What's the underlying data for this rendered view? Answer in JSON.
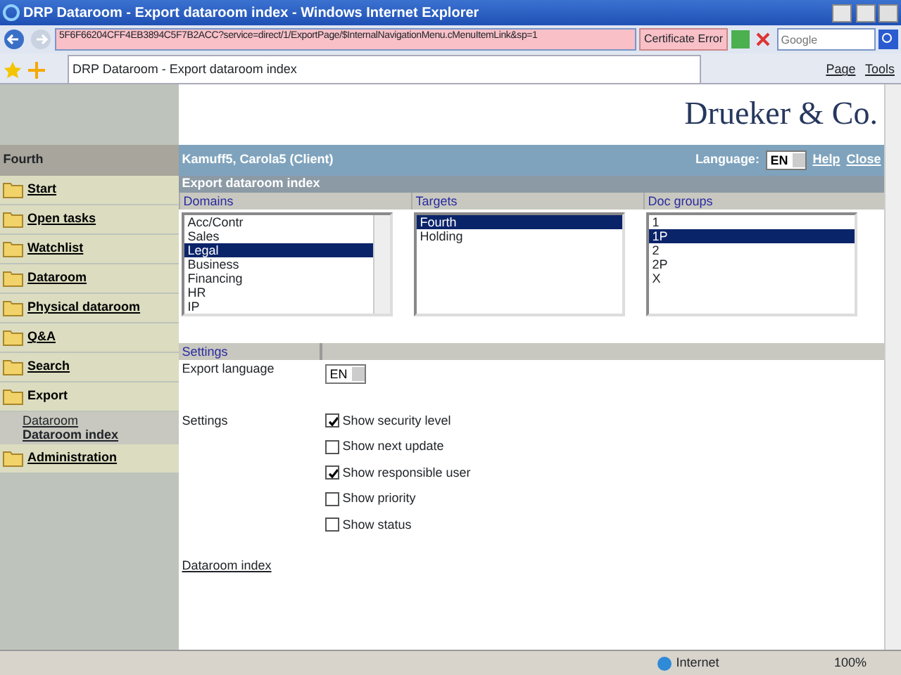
{
  "window": {
    "title": "DRP Dataroom - Export dataroom index - Windows Internet Explorer"
  },
  "address_bar": {
    "url": "5F6F66204CFF4EB3894C5F7B2ACC?service=direct/1/ExportPage/$InternalNavigationMenu.cMenuItemLink&sp=1",
    "certificate_error": "Certificate Error",
    "search": {
      "placeholder": "Google"
    }
  },
  "tabs": [
    {
      "label": "DRP Dataroom - Export dataroom index",
      "selected": true
    }
  ],
  "toolbar": {
    "items": [
      "Page",
      "Tools"
    ]
  },
  "sidebar": {
    "context": "Fourth",
    "items": [
      {
        "label": "Start",
        "selected": false
      },
      {
        "label": "Open tasks",
        "selected": false
      },
      {
        "label": "Watchlist",
        "selected": false
      },
      {
        "label": "Dataroom",
        "selected": false
      },
      {
        "label": "Physical dataroom",
        "selected": false
      },
      {
        "label": "Q&A",
        "selected": false
      },
      {
        "label": "Search",
        "selected": false
      },
      {
        "label": "Export",
        "selected": true,
        "children": [
          {
            "label": "Dataroom",
            "selected": false
          },
          {
            "label": "Dataroom index",
            "selected": true
          }
        ]
      },
      {
        "label": "Administration",
        "selected": false
      }
    ]
  },
  "header": {
    "logo": "Drueker & Co.",
    "user": "Kamuff5, Carola5 (Client)",
    "language_label": "Language:",
    "language": "EN",
    "links": [
      "Help",
      "Close"
    ]
  },
  "page_title": "Export dataroom index",
  "lists": [
    {
      "heading": "Domains",
      "items": [
        {
          "label": "Acc/Contr",
          "selected": false
        },
        {
          "label": "Sales",
          "selected": false
        },
        {
          "label": "Legal",
          "selected": true
        },
        {
          "label": "Business",
          "selected": false
        },
        {
          "label": "Financing",
          "selected": false
        },
        {
          "label": "HR",
          "selected": false
        },
        {
          "label": "IP",
          "selected": false
        }
      ]
    },
    {
      "heading": "Targets",
      "items": [
        {
          "label": "Fourth",
          "selected": true
        },
        {
          "label": "Holding",
          "selected": false
        }
      ]
    },
    {
      "heading": "Doc groups",
      "items": [
        {
          "label": "1",
          "selected": false
        },
        {
          "label": "1P",
          "selected": true
        },
        {
          "label": "2",
          "selected": false
        },
        {
          "label": "2P",
          "selected": false
        },
        {
          "label": "X",
          "selected": false
        }
      ]
    }
  ],
  "settings": {
    "heading": "Settings",
    "export_language_label": "Export language",
    "export_language": "EN",
    "settings_label": "Settings",
    "options": [
      {
        "label": "Show security level",
        "checked": true
      },
      {
        "label": "Show next update",
        "checked": false
      },
      {
        "label": "Show responsible user",
        "checked": true
      },
      {
        "label": "Show priority",
        "checked": false
      },
      {
        "label": "Show status",
        "checked": false
      }
    ]
  },
  "footer_link": "Dataroom index",
  "status_bar": {
    "zone": "Internet",
    "zoom": "100%"
  }
}
